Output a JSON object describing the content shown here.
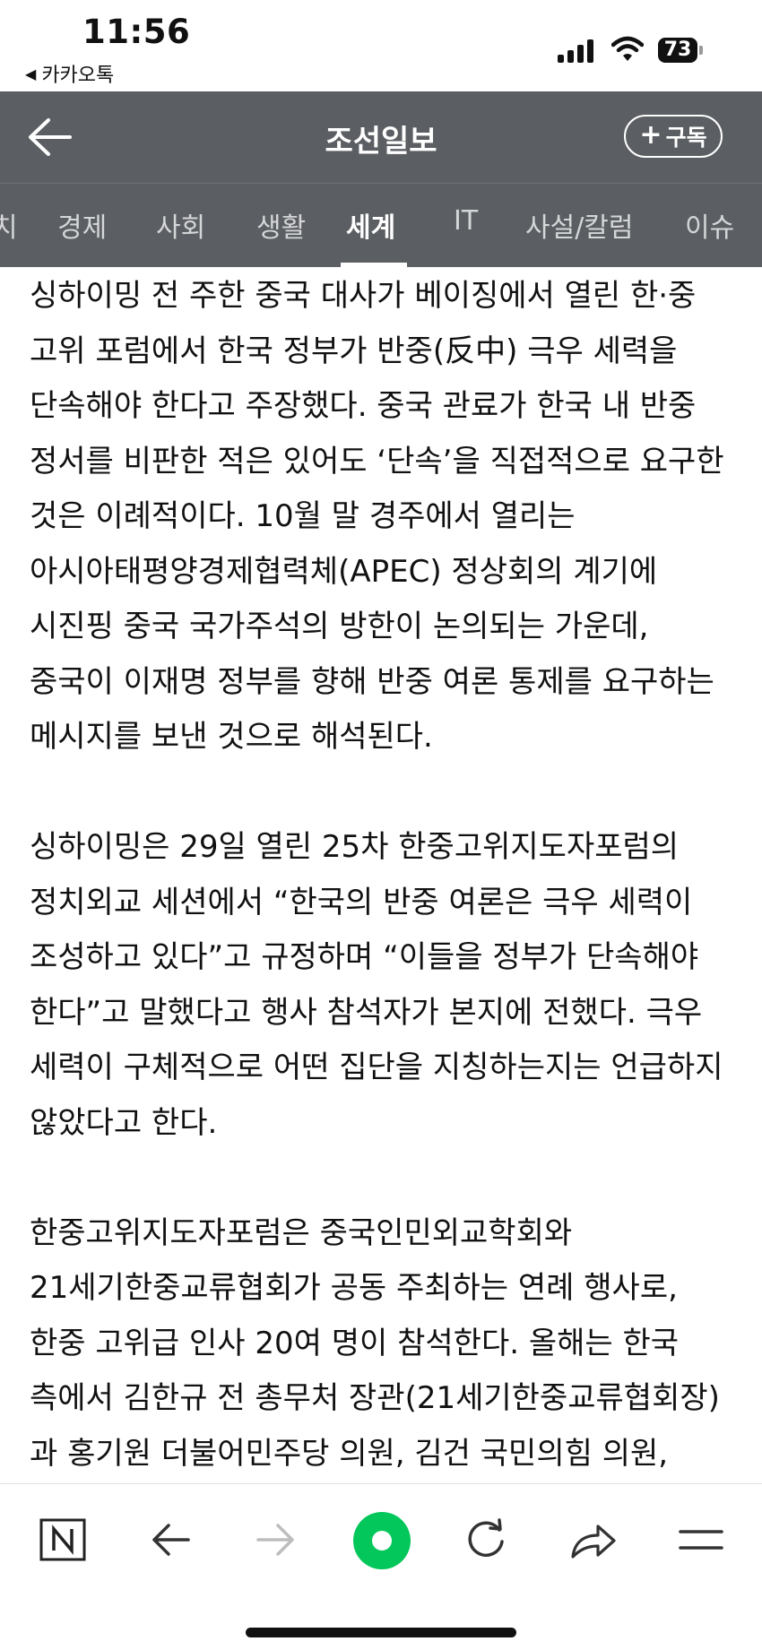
{
  "status_bar": {
    "time": "11:56",
    "back_app": "카카오톡",
    "battery": "73"
  },
  "header": {
    "title": "조선일보",
    "subscribe_label": "구독",
    "back_icon": "arrow-left-icon",
    "bg_color": "#5b5e62"
  },
  "tabs": {
    "items": [
      {
        "label": "치"
      },
      {
        "label": "경제"
      },
      {
        "label": "사회"
      },
      {
        "label": "생활"
      },
      {
        "label": "세계"
      },
      {
        "label": "IT"
      },
      {
        "label": "사설/칼럼"
      },
      {
        "label": "이슈"
      }
    ],
    "active": "세계"
  },
  "article": {
    "paragraphs": [
      "싱하이밍 전 주한 중국 대사가 베이징에서 열린 한·중 고위 포럼에서 한국 정부가 반중(反中) 극우 세력을 단속해야 한다고 주장했다. 중국 관료가 한국 내 반중 정서를 비판한 적은 있어도 ‘단속’을 직접적으로 요구한 것은 이례적이다. 10월 말 경주에서 열리는 아시아태평양경제협력체(APEC) 정상회의 계기에 시진핑 중국 국가주석의 방한이 논의되는 가운데, 중국이 이재명 정부를 향해 반중 여론 통제를 요구하는 메시지를 보낸 것으로 해석된다.",
      "싱하이밍은 29일 열린 25차 한중고위지도자포럼의 정치외교 세션에서 “한국의 반중 여론은 극우 세력이 조성하고 있다”고 규정하며 “이들을 정부가 단속해야 한다”고 말했다고 행사 참석자가 본지에 전했다. 극우 세력이 구체적으로 어떤 집단을 지칭하는지는 언급하지 않았다고 한다.",
      "한중고위지도자포럼은 중국인민외교학회와 21세기한중교류협회가 공동 주최하는 연례 행사로, 한중 고위급 인사 20여 명이 참석한다. 올해는 한국 측에서 김한규 전 총무처 장관(21세기한중교류협회장)과 홍기원 더불어민주당 의원, 김건 국민의힘 의원, 하태경"
    ]
  },
  "toolbar": {
    "icons": [
      "naver-n-icon",
      "back-arrow-icon",
      "forward-arrow-icon",
      "green-dot-icon",
      "refresh-icon",
      "share-icon",
      "menu-icon"
    ],
    "accent_color": "#03c75a"
  }
}
